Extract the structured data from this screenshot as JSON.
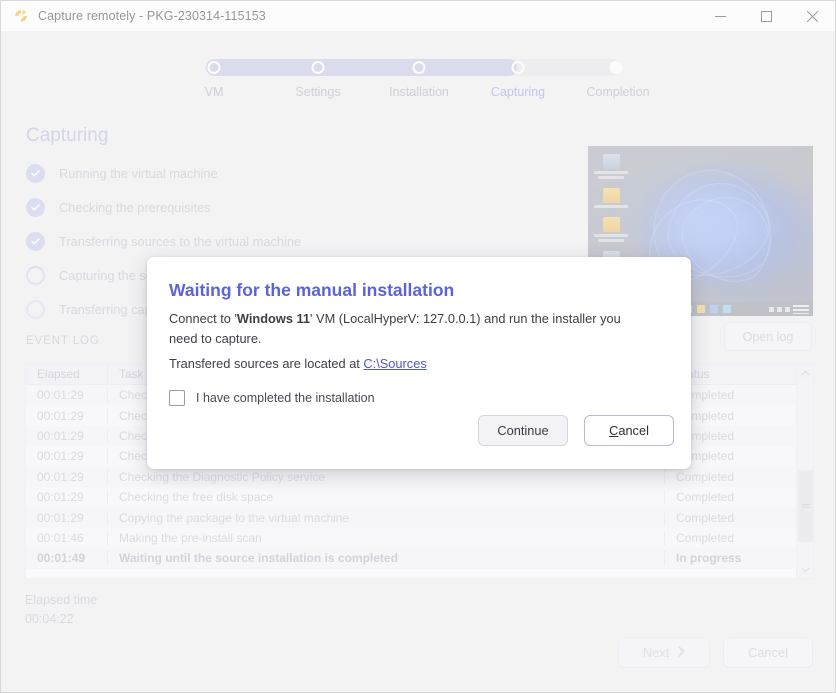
{
  "window": {
    "title": "Capture remotely - PKG-230314-115153",
    "app_icon": "app-logo-icon",
    "minimize": "—",
    "maximize": "☐",
    "close": "✕"
  },
  "stepper": {
    "steps": [
      {
        "label": "VM",
        "state": "done"
      },
      {
        "label": "Settings",
        "state": "done"
      },
      {
        "label": "Installation",
        "state": "done"
      },
      {
        "label": "Capturing",
        "state": "current"
      },
      {
        "label": "Completion",
        "state": "pending"
      }
    ]
  },
  "page": {
    "heading": "Capturing",
    "tasks": [
      {
        "label": "Running the virtual machine",
        "state": "done"
      },
      {
        "label": "Checking the prerequisites",
        "state": "done"
      },
      {
        "label": "Transferring sources to the virtual machine",
        "state": "done"
      },
      {
        "label": "Capturing the source installation",
        "state": "pending"
      },
      {
        "label": "Transferring captured package",
        "state": "pending"
      }
    ]
  },
  "vm_preview": {
    "name": "vm-desktop-preview",
    "icons": [
      "This PC",
      "Users",
      "Log Folder",
      "Capture App"
    ]
  },
  "event_log": {
    "section_title": "EVENT LOG",
    "open_log_label": "Open log",
    "columns": [
      "Elapsed",
      "Task",
      "Status"
    ],
    "rows": [
      {
        "elapsed": "00:01:29",
        "task": "Checking the operating system",
        "status": "Completed",
        "bold": false
      },
      {
        "elapsed": "00:01:29",
        "task": "Checking the installed software",
        "status": "Completed",
        "bold": false
      },
      {
        "elapsed": "00:01:29",
        "task": "Checking the Windows Installer service",
        "status": "Completed",
        "bold": false
      },
      {
        "elapsed": "00:01:29",
        "task": "Checking the Windows Search service",
        "status": "Completed",
        "bold": false
      },
      {
        "elapsed": "00:01:29",
        "task": "Checking the Diagnostic Policy service",
        "status": "Completed",
        "bold": false
      },
      {
        "elapsed": "00:01:29",
        "task": "Checking the free disk space",
        "status": "Completed",
        "bold": false
      },
      {
        "elapsed": "00:01:29",
        "task": "Copying the package to the virtual machine",
        "status": "Completed",
        "bold": false
      },
      {
        "elapsed": "00:01:46",
        "task": "Making the pre-install scan",
        "status": "Completed",
        "bold": false
      },
      {
        "elapsed": "00:01:49",
        "task": "Waiting until the source installation is completed",
        "status": "In progress",
        "bold": true
      }
    ]
  },
  "footer": {
    "elapsed_label": "Elapsed time",
    "elapsed_value": "00:04:22",
    "next_label": "Next",
    "next_icon": "chevron-right-icon",
    "cancel_label": "Cancel"
  },
  "dialog": {
    "title": "Waiting for the manual installation",
    "body_prefix": "Connect to '",
    "body_vm": "Windows 11",
    "body_suffix": "' VM (LocalHyperV: 127.0.0.1) and run the installer you need to capture.",
    "body2_prefix": "Transfered sources are located at ",
    "body2_link": "C:\\Sources",
    "checkbox_label": "I have completed the installation",
    "checkbox_checked": false,
    "continue_label": "Continue",
    "cancel_label": "Cancel",
    "cancel_accel": "C",
    "cancel_rest": "ancel"
  },
  "colors": {
    "accent": "#5b63d6",
    "stepper_fill": "#b4b9de",
    "stepper_track": "#dededf",
    "heading": "#a7a9c9",
    "window_bg": "#ececec"
  }
}
